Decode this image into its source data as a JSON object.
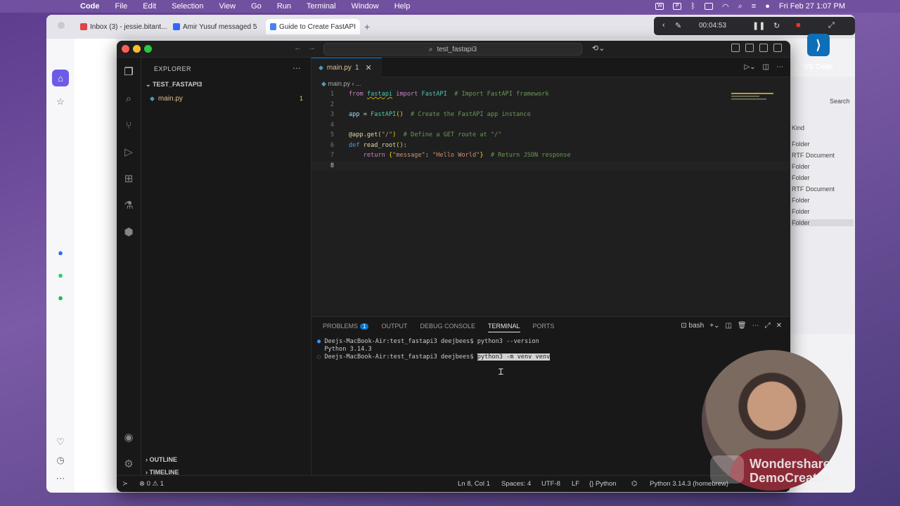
{
  "menubar": {
    "app": "Code",
    "items": [
      "File",
      "Edit",
      "Selection",
      "View",
      "Go",
      "Run",
      "Terminal",
      "Window",
      "Help"
    ],
    "clock": "Fri Feb 27  1:07 PM"
  },
  "browser": {
    "tabs": [
      {
        "label": "Inbox (3) - jessie.bitant..."
      },
      {
        "label": "Amir Yusuf messaged 5"
      },
      {
        "label": "Guide to Create FastAPI"
      }
    ],
    "right_panel": {
      "search_label": "Search",
      "kind_label": "Kind",
      "items": [
        "Folder",
        "RTF Document",
        "Folder",
        "Folder",
        "RTF Document",
        "Folder",
        "Folder",
        "Folder"
      ]
    }
  },
  "recorder": {
    "time": "00:04:53"
  },
  "dock": {
    "vscode_label": "VS Code"
  },
  "vscode": {
    "search": "test_fastapi3",
    "explorer": {
      "title": "EXPLORER",
      "folder": "TEST_FASTAPI3",
      "file": "main.py",
      "file_problems": "1",
      "outline": "OUTLINE",
      "timeline": "TIMELINE"
    },
    "tab": {
      "name": "main.py",
      "problems": "1"
    },
    "breadcrumb": "main.py › ...",
    "code_lines": [
      "from fastapi import FastAPI  # Import FastAPI framework",
      "",
      "app = FastAPI()  # Create the FastAPI app instance",
      "",
      "@app.get(\"/\")  # Define a GET route at \"/\"",
      "def read_root():",
      "    return {\"message\": \"Hello World\"}  # Return JSON response",
      ""
    ],
    "panel": {
      "tabs": [
        "PROBLEMS",
        "OUTPUT",
        "DEBUG CONSOLE",
        "TERMINAL",
        "PORTS"
      ],
      "problems_badge": "1",
      "active": "TERMINAL",
      "shell": "bash"
    },
    "terminal": {
      "prompt": "Deejs-MacBook-Air:test_fastapi3 deejbees$",
      "cmd1": "python3 --version",
      "out1": "Python 3.14.3",
      "cmd2": "python3 -m venv venv"
    },
    "status": {
      "errors": "0",
      "warnings": "1",
      "position": "Ln 8, Col 1",
      "spaces": "Spaces: 4",
      "encoding": "UTF-8",
      "eol": "LF",
      "language": "Python",
      "interpreter": "Python 3.14.3 (homebrew)"
    }
  },
  "watermark": {
    "line1": "Wondershare",
    "line2": "DemoCreator"
  }
}
